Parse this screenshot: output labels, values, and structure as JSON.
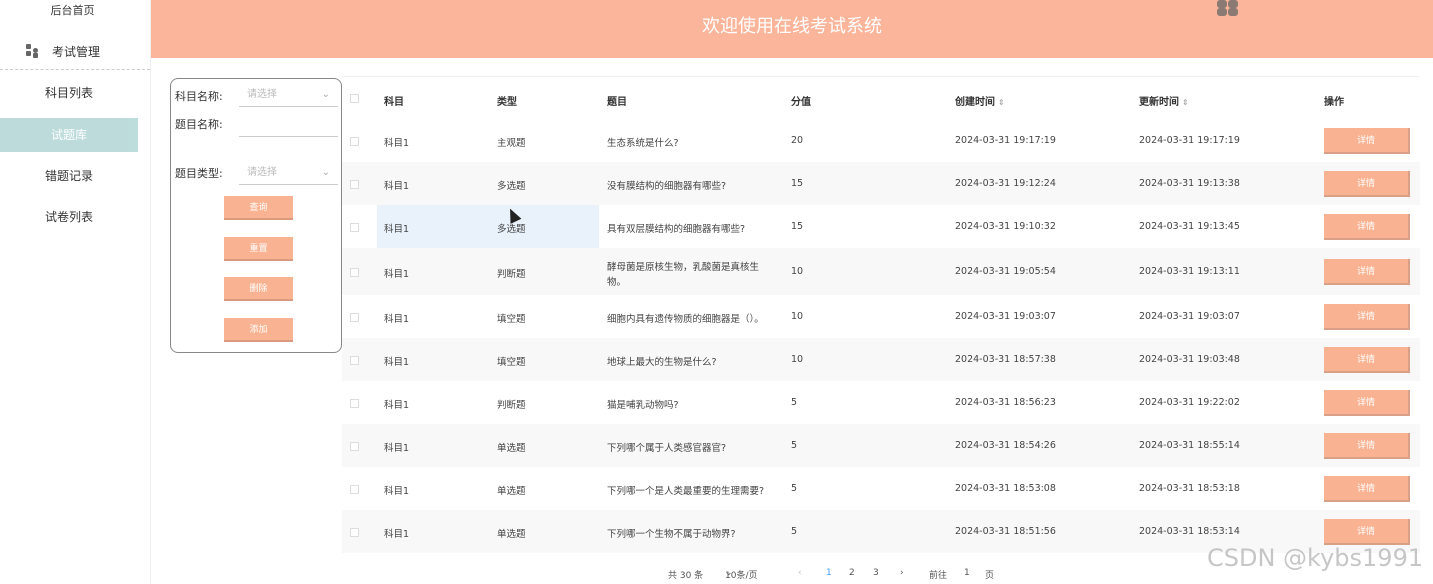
{
  "sidebar": {
    "home": "后台首页",
    "group": "考试管理",
    "items": [
      {
        "label": "科目列表"
      },
      {
        "label": "试题库"
      },
      {
        "label": "错题记录"
      },
      {
        "label": "试卷列表"
      }
    ]
  },
  "header": {
    "title": "欢迎使用在线考试系统"
  },
  "filter": {
    "subject_label": "科目名称:",
    "subject_placeholder": "请选择",
    "question_label": "题目名称:",
    "question_value": "",
    "type_label": "题目类型:",
    "type_placeholder": "请选择",
    "buttons": [
      "查询",
      "重置",
      "删除",
      "添加"
    ]
  },
  "table": {
    "headers": [
      "科目",
      "类型",
      "题目",
      "分值",
      "创建时间",
      "更新时间",
      "操作"
    ],
    "detail_label": "详情",
    "rows": [
      {
        "subject": "科目1",
        "type": "主观题",
        "question": "生态系统是什么?",
        "score": "20",
        "created": "2024-03-31 19:17:19",
        "updated": "2024-03-31 19:17:19"
      },
      {
        "subject": "科目1",
        "type": "多选题",
        "question": "没有膜结构的细胞器有哪些?",
        "score": "15",
        "created": "2024-03-31 19:12:24",
        "updated": "2024-03-31 19:13:38"
      },
      {
        "subject": "科目1",
        "type": "多选题",
        "question": "具有双层膜结构的细胞器有哪些?",
        "score": "15",
        "created": "2024-03-31 19:10:32",
        "updated": "2024-03-31 19:13:45"
      },
      {
        "subject": "科目1",
        "type": "判断题",
        "question": "酵母菌是原核生物，乳酸菌是真核生",
        "question2": "物。",
        "score": "10",
        "created": "2024-03-31 19:05:54",
        "updated": "2024-03-31 19:13:11"
      },
      {
        "subject": "科目1",
        "type": "填空题",
        "question": "细胞内具有遗传物质的细胞器是（）。",
        "score": "10",
        "created": "2024-03-31 19:03:07",
        "updated": "2024-03-31 19:03:07"
      },
      {
        "subject": "科目1",
        "type": "填空题",
        "question": "地球上最大的生物是什么?",
        "score": "10",
        "created": "2024-03-31 18:57:38",
        "updated": "2024-03-31 19:03:48"
      },
      {
        "subject": "科目1",
        "type": "判断题",
        "question": "猫是哺乳动物吗?",
        "score": "5",
        "created": "2024-03-31 18:56:23",
        "updated": "2024-03-31 19:22:02"
      },
      {
        "subject": "科目1",
        "type": "单选题",
        "question": "下列哪个属于人类感官器官?",
        "score": "5",
        "created": "2024-03-31 18:54:26",
        "updated": "2024-03-31 18:55:14"
      },
      {
        "subject": "科目1",
        "type": "单选题",
        "question": "下列哪一个是人类最重要的生理需要?",
        "score": "5",
        "created": "2024-03-31 18:53:08",
        "updated": "2024-03-31 18:53:18"
      },
      {
        "subject": "科目1",
        "type": "单选题",
        "question": "下列哪一个生物不属于动物界?",
        "score": "5",
        "created": "2024-03-31 18:51:56",
        "updated": "2024-03-31 18:53:14"
      }
    ]
  },
  "pager": {
    "total": "共 30 条",
    "page_size": "10条/页",
    "prev": "‹",
    "pages": [
      "1",
      "2",
      "3"
    ],
    "next": "›",
    "goto_label": "前往",
    "goto_value": "1",
    "goto_suffix": "页"
  },
  "watermark": "CSDN @kybs1991",
  "colors": {
    "accent": "#fbb59a",
    "active": "#b6d8d8"
  }
}
